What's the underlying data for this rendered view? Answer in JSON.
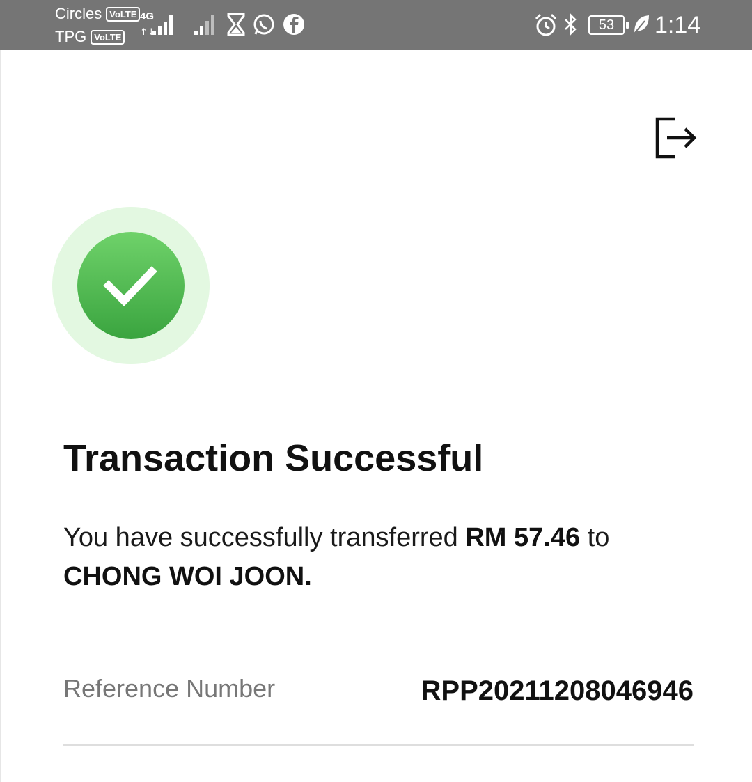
{
  "status_bar": {
    "carrier1": "Circles",
    "carrier1_badge": "VoLTE",
    "carrier2": "TPG",
    "carrier2_badge": "VoLTE",
    "network": "4G",
    "battery": "53",
    "time": "1:14",
    "icons": [
      "signal-icon",
      "signal-weak-icon",
      "hourglass-icon",
      "whatsapp-icon",
      "facebook-icon",
      "alarm-icon",
      "bluetooth-icon",
      "battery-icon",
      "leaf-icon"
    ]
  },
  "header": {
    "exit_icon": "exit-icon"
  },
  "result": {
    "status_icon": "check-icon",
    "status_color": "#3aa43f",
    "title": "Transaction Successful",
    "message_prefix": "You have successfully transferred ",
    "amount": "RM 57.46",
    "message_mid": " to",
    "recipient": "CHONG WOI JOON."
  },
  "details": {
    "reference_label": "Reference Number",
    "reference_value": "RPP20211208046946"
  }
}
